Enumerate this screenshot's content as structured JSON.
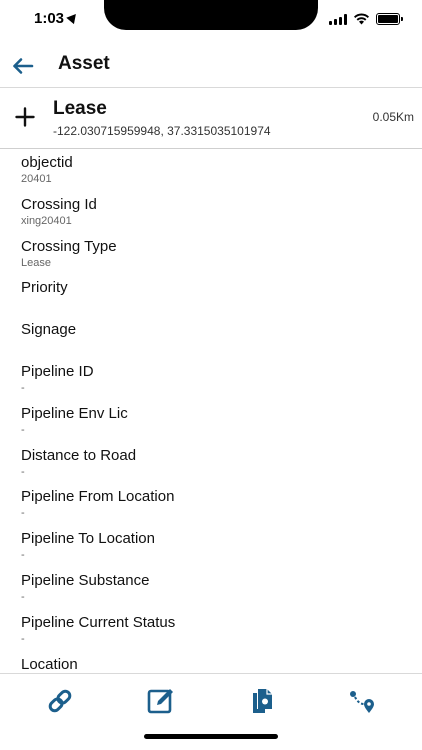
{
  "status_bar": {
    "time": "1:03"
  },
  "nav": {
    "title": "Asset"
  },
  "asset": {
    "name": "Lease",
    "coords": "-122.030715959948, 37.3315035101974",
    "distance": "0.05Km"
  },
  "attributes": [
    {
      "label": "objectid",
      "value": "20401"
    },
    {
      "label": "Crossing Id",
      "value": "xing20401"
    },
    {
      "label": "Crossing Type",
      "value": "Lease"
    },
    {
      "label": "Priority",
      "value": ""
    },
    {
      "label": "Signage",
      "value": ""
    },
    {
      "label": "Pipeline ID",
      "value": "-"
    },
    {
      "label": "Pipeline Env Lic",
      "value": "-"
    },
    {
      "label": "Distance to Road",
      "value": "-"
    },
    {
      "label": "Pipeline From Location",
      "value": "-"
    },
    {
      "label": "Pipeline To Location",
      "value": "-"
    },
    {
      "label": "Pipeline Substance",
      "value": "-"
    },
    {
      "label": "Pipeline Current Status",
      "value": "-"
    },
    {
      "label": "Location",
      "value": ""
    }
  ],
  "toolbar": {
    "icons": [
      "link-icon",
      "edit-icon",
      "documents-icon",
      "route-icon"
    ]
  },
  "colors": {
    "accent": "#1c5f8c",
    "text": "#111111",
    "secondary_text": "#666666",
    "divider": "#d9d9d9"
  }
}
